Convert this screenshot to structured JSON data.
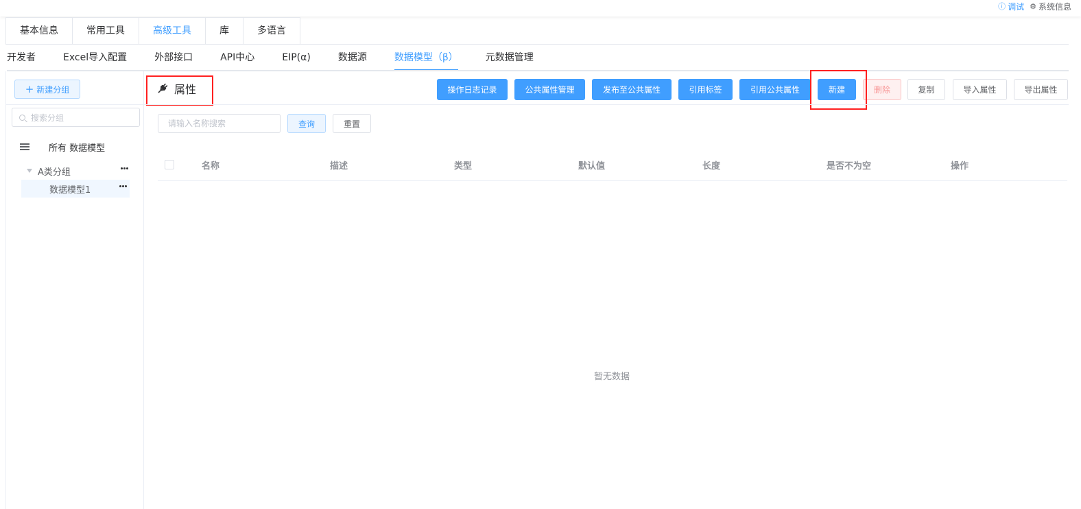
{
  "topbar": {
    "debug_icon": "info-icon",
    "debug_label": "调试",
    "system_icon": "gear-icon",
    "system_label": "系统信息"
  },
  "main_tabs": [
    {
      "label": "基本信息",
      "active": false
    },
    {
      "label": "常用工具",
      "active": false
    },
    {
      "label": "高级工具",
      "active": true
    },
    {
      "label": "库",
      "active": false
    },
    {
      "label": "多语言",
      "active": false
    }
  ],
  "sub_tabs": [
    {
      "label": "开发者",
      "active": false
    },
    {
      "label": "Excel导入配置",
      "active": false
    },
    {
      "label": "外部接口",
      "active": false
    },
    {
      "label": "API中心",
      "active": false
    },
    {
      "label": "EIP(α)",
      "active": false
    },
    {
      "label": "数据源",
      "active": false
    },
    {
      "label": "数据模型（β）",
      "active": true
    },
    {
      "label": "元数据管理",
      "active": false
    }
  ],
  "sidebar": {
    "new_group_label": "新建分组",
    "search_placeholder": "搜索分组",
    "all_label": "所有 数据模型",
    "groups": [
      {
        "label": "A类分组",
        "children": [
          {
            "label": "数据模型1",
            "selected": true
          }
        ]
      }
    ]
  },
  "main": {
    "title": "属性",
    "title_icon": "plug-icon",
    "toolbar": {
      "log": "操作日志记录",
      "public_manage": "公共属性管理",
      "publish": "发布至公共属性",
      "ref_tag": "引用标签",
      "ref_public": "引用公共属性",
      "new": "新建",
      "delete": "删除",
      "copy": "复制",
      "import": "导入属性",
      "export": "导出属性"
    },
    "search": {
      "placeholder": "请输入名称搜索",
      "value": "",
      "query_label": "查询",
      "reset_label": "重置"
    },
    "table": {
      "columns": [
        "名称",
        "描述",
        "类型",
        "默认值",
        "长度",
        "是否不为空",
        "操作"
      ],
      "rows": [],
      "empty_text": "暂无数据"
    }
  },
  "colors": {
    "primary": "#409eff",
    "danger": "#f56c6c",
    "highlight_box": "#ff2020"
  }
}
